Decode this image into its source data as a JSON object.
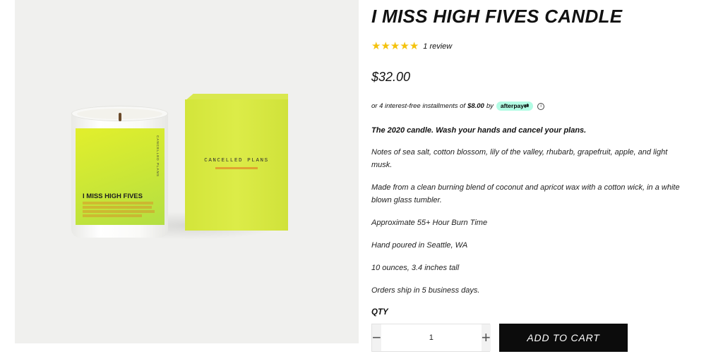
{
  "product": {
    "title": "I MISS HIGH FIVES CANDLE",
    "rating_value": 5,
    "rating_max": 5,
    "review_text": "1 review",
    "price": "$32.00",
    "installments": {
      "prefix": "or 4 interest-free installments of",
      "amount": "$8.00",
      "by": "by",
      "provider": "afterpay"
    },
    "tagline": "The 2020 candle. Wash your hands and cancel your plans.",
    "notes": "Notes of sea salt, cotton blossom, lily of the valley, rhubarb, grapefruit, apple, and light musk.",
    "materials": "Made from a clean burning blend of coconut and apricot wax with a cotton wick, in a white blown glass tumbler.",
    "burn_time": "Approximate 55+ Hour Burn Time",
    "origin": "Hand poured in Seattle, WA",
    "size": "10 ounces, 3.4 inches tall",
    "shipping": "Orders ship in 5 business days."
  },
  "image": {
    "jar_label_name": "I MISS HIGH FIVES",
    "box_brand": "CANCELLED PLANS"
  },
  "purchase": {
    "qty_label": "QTY",
    "qty_value": "1",
    "decrement": "−",
    "increment": "+",
    "add_to_cart": "ADD TO CART"
  },
  "colors": {
    "star": "#f4c20d",
    "afterpay": "#b2fce4",
    "button": "#0c0c0c",
    "candle_label": "#d4e83a"
  }
}
